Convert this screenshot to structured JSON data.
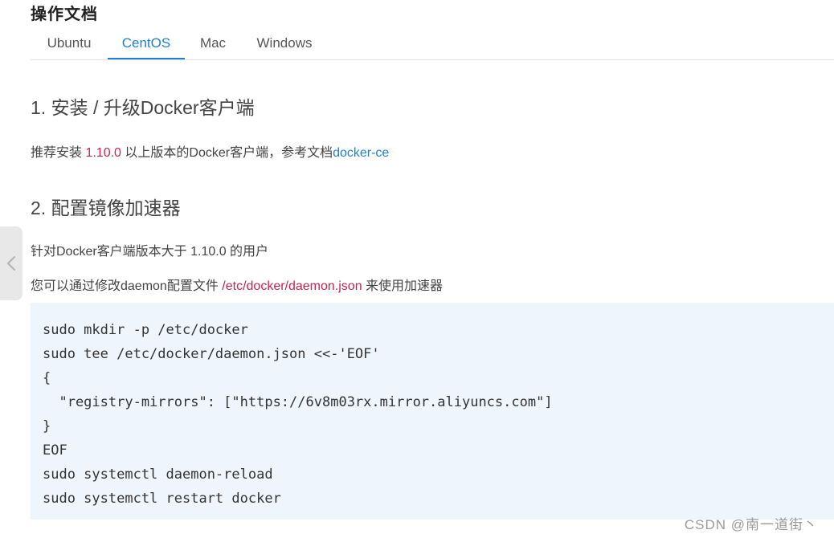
{
  "page": {
    "title": "操作文档"
  },
  "tabs": [
    {
      "label": "Ubuntu",
      "active": false
    },
    {
      "label": "CentOS",
      "active": true
    },
    {
      "label": "Mac",
      "active": false
    },
    {
      "label": "Windows",
      "active": false
    }
  ],
  "section1": {
    "heading": "1. 安装 / 升级Docker客户端",
    "para_pre": "推荐安装 ",
    "version": "1.10.0",
    "para_mid": " 以上版本的Docker客户端，参考文档",
    "link": "docker-ce"
  },
  "section2": {
    "heading": "2. 配置镜像加速器",
    "para1": "针对Docker客户端版本大于 1.10.0 的用户",
    "para2_pre": "您可以通过修改daemon配置文件 ",
    "path": "/etc/docker/daemon.json",
    "para2_post": " 来使用加速器"
  },
  "code": {
    "lines": [
      "sudo mkdir -p /etc/docker",
      "sudo tee /etc/docker/daemon.json <<-'EOF'",
      "{",
      "  \"registry-mirrors\": [\"https://6v8m03rx.mirror.aliyuncs.com\"]",
      "}",
      "EOF",
      "sudo systemctl daemon-reload",
      "sudo systemctl restart docker"
    ]
  },
  "sidebar": {
    "collapse_icon": "chevron-left-icon"
  },
  "watermark": "CSDN @南一道街丶",
  "colors": {
    "accent": "#1e80d4",
    "inline_code": "#c7254e",
    "code_bg": "#eef5fd"
  }
}
